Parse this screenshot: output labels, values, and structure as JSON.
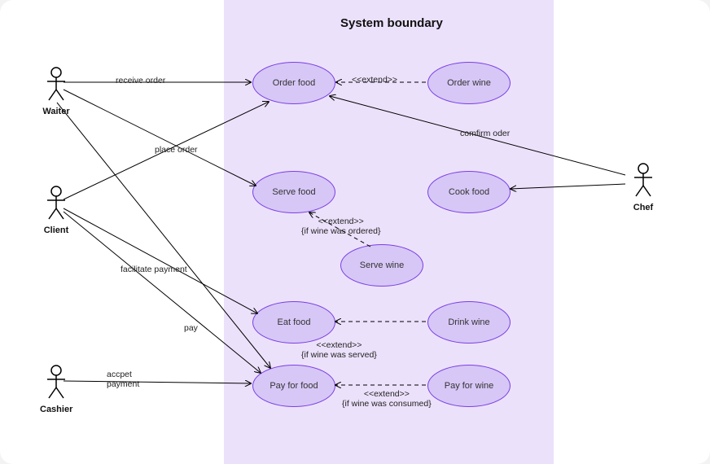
{
  "title": "System boundary",
  "actors": {
    "waiter": {
      "label": "Waiter"
    },
    "client": {
      "label": "Client"
    },
    "cashier": {
      "label": "Cashier"
    },
    "chef": {
      "label": "Chef"
    }
  },
  "usecases": {
    "order_food": {
      "label": "Order food"
    },
    "order_wine": {
      "label": "Order wine"
    },
    "serve_food": {
      "label": "Serve food"
    },
    "cook_food": {
      "label": "Cook food"
    },
    "serve_wine": {
      "label": "Serve wine"
    },
    "eat_food": {
      "label": "Eat food"
    },
    "drink_wine": {
      "label": "Drink wine"
    },
    "pay_food": {
      "label": "Pay for food"
    },
    "pay_wine": {
      "label": "Pay for wine"
    }
  },
  "edge_labels": {
    "receive_order": "receive order",
    "place_order": "place order",
    "facilitate_payment": "facilitate payment",
    "pay": "pay",
    "accept_payment": "accpet\npayment",
    "confirm_order": "comfirm oder"
  },
  "extensions": {
    "order_wine_ext": "<<extend>>",
    "serve_wine_ext": "<<extend>>\n{if wine was ordered}",
    "drink_wine_ext": "<<extend>>\n{if wine was served}",
    "pay_wine_ext": "<<extend>>\n{if wine was consumed}"
  }
}
